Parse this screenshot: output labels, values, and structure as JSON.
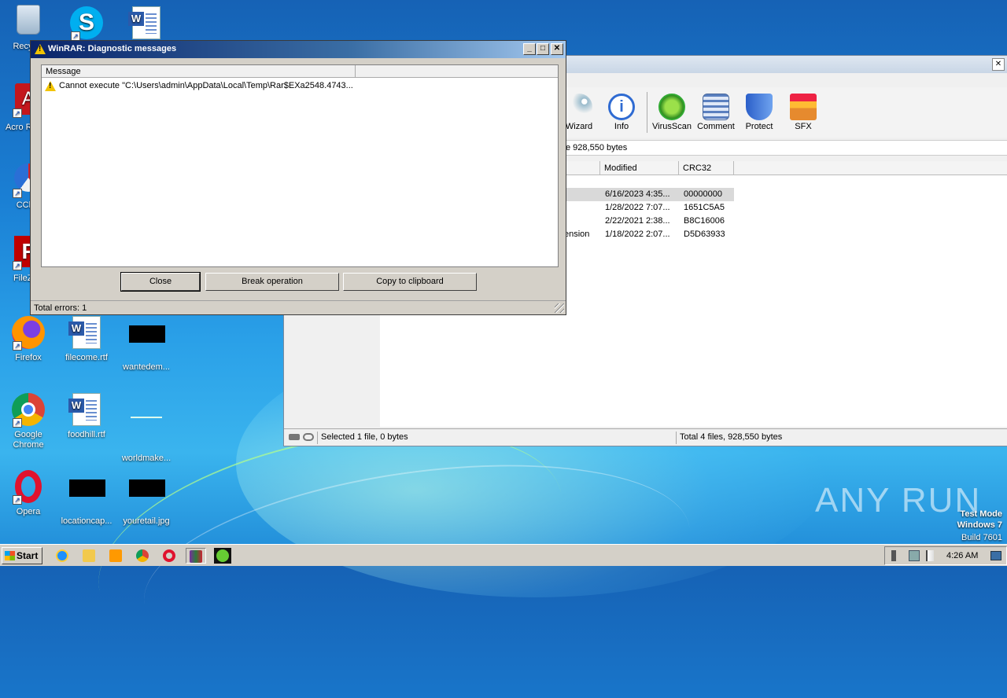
{
  "desktop": {
    "icons": [
      {
        "label": "Recycle"
      },
      {
        "label": "Skype"
      },
      {
        "label": "Word"
      },
      {
        "label": "Acro Reade"
      },
      {
        "label": "CClea"
      },
      {
        "label": "FileZilla"
      },
      {
        "label": "Firefox"
      },
      {
        "label": "filecome.rtf"
      },
      {
        "label": "wantedem..."
      },
      {
        "label": "Google Chrome"
      },
      {
        "label": "foodhill.rtf"
      },
      {
        "label": "worldmake..."
      },
      {
        "label": "Opera"
      },
      {
        "label": "locationcap..."
      },
      {
        "label": "youretail.jpg"
      }
    ]
  },
  "winrar_main": {
    "toolbar": [
      {
        "label": "Wizard",
        "icon": "wizard-icon"
      },
      {
        "label": "Info",
        "icon": "info-icon"
      },
      {
        "label": "VirusScan",
        "icon": "virusscan-icon"
      },
      {
        "label": "Comment",
        "icon": "comment-icon"
      },
      {
        "label": "Protect",
        "icon": "protect-icon"
      },
      {
        "label": "SFX",
        "icon": "sfx-icon"
      }
    ],
    "address_text": "e 928,550 bytes",
    "columns": {
      "modified": "Modified",
      "crc": "CRC32"
    },
    "rows": [
      {
        "name": "",
        "modified": "6/16/2023 4:35...",
        "crc": "00000000"
      },
      {
        "name": "",
        "modified": "1/28/2022 7:07...",
        "crc": "1651C5A5"
      },
      {
        "name": "",
        "modified": "2/22/2021 2:38...",
        "crc": "B8C16006"
      },
      {
        "name": "ension",
        "modified": "1/18/2022 2:07...",
        "crc": "D5D63933"
      }
    ],
    "status": {
      "selected": "Selected 1 file, 0 bytes",
      "total": "Total 4 files, 928,550 bytes"
    }
  },
  "dialog": {
    "title": "WinRAR: Diagnostic messages",
    "column": "Message",
    "message": "Cannot execute \"C:\\Users\\admin\\AppData\\Local\\Temp\\Rar$EXa2548.4743...",
    "buttons": {
      "close": "Close",
      "break": "Break operation",
      "copy": "Copy to clipboard"
    },
    "status": "Total errors: 1",
    "caption": {
      "minimize": "_",
      "maximize": "□",
      "close": "✕"
    }
  },
  "taskbar": {
    "start": "Start",
    "clock": "4:26 AM"
  },
  "watermark": {
    "brand": "ANY RUN",
    "mode": "Test Mode",
    "os": "Windows 7",
    "build": "Build 7601"
  }
}
